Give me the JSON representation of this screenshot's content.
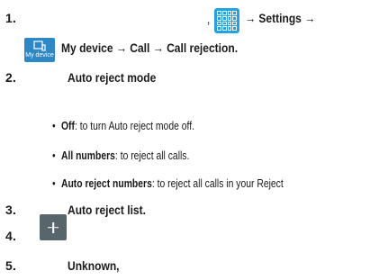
{
  "document": {
    "steps": [
      {
        "number": "1.",
        "comma": ",",
        "arrow_settings": "→ Settings →",
        "line2": "My device → Call → Call rejection."
      },
      {
        "number": "2.",
        "label": "Auto reject mode"
      },
      {
        "number": "3.",
        "label": "Auto reject list."
      },
      {
        "number": "4."
      },
      {
        "number": "5.",
        "label": "Unknown,"
      }
    ],
    "bullets": [
      {
        "term": "Off",
        "text": ": to turn Auto reject mode off."
      },
      {
        "term": "All numbers",
        "text": ": to reject all calls."
      },
      {
        "term": "Auto reject numbers",
        "text": ": to reject all calls in your Reject"
      }
    ],
    "icons": {
      "apps": "apps-grid-icon",
      "my_device": "my-device-icon",
      "add": "plus-icon"
    },
    "icon_text": {
      "my_device_caption": "My device"
    },
    "colors": {
      "accent_blue": "#24a1de",
      "my_device_blue": "#2f88c6",
      "plus_gray": "#59656d",
      "text": "#1a1a1a"
    }
  }
}
